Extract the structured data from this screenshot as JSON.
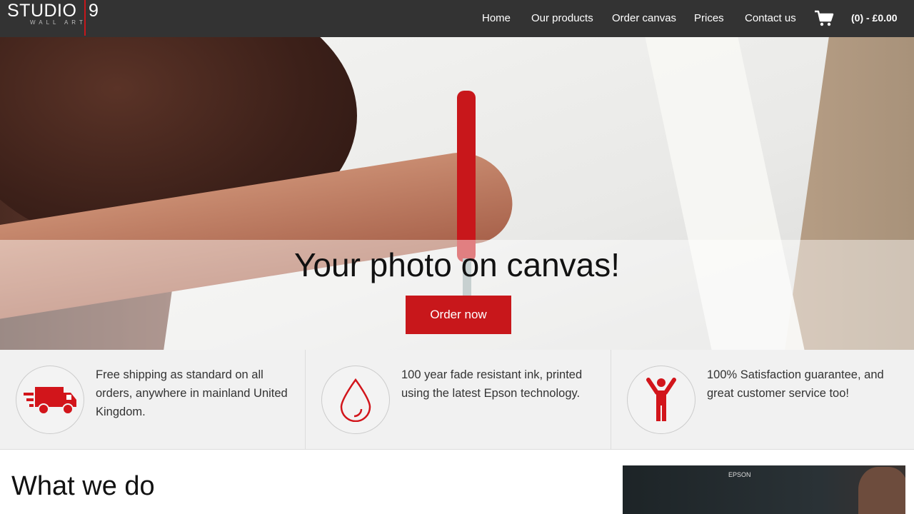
{
  "brand": {
    "name": "STUDIO",
    "number": "9",
    "tagline": "WALL ART"
  },
  "nav": {
    "items": [
      {
        "label": "Home"
      },
      {
        "label": "Our products"
      },
      {
        "label": "Order canvas"
      },
      {
        "label": "Prices"
      },
      {
        "label": "Contact us"
      }
    ],
    "cart_total": "(0) - £0.00"
  },
  "hero": {
    "title": "Your photo on canvas!",
    "cta_label": "Order now"
  },
  "features": [
    {
      "icon": "truck-icon",
      "text": "Free shipping as standard on all orders, anywhere in mainland United Kingdom."
    },
    {
      "icon": "ink-drop-icon",
      "text": "100 year fade resistant ink, printed using the latest Epson technology."
    },
    {
      "icon": "person-cheering-icon",
      "text": "100% Satisfaction guarantee, and great customer service too!"
    }
  ],
  "section": {
    "heading": "What we do"
  },
  "video": {
    "brand_text": "EPSON"
  },
  "colors": {
    "accent": "#c8171b",
    "nav_bg": "#333333",
    "feature_bg": "#f1f1f1"
  }
}
